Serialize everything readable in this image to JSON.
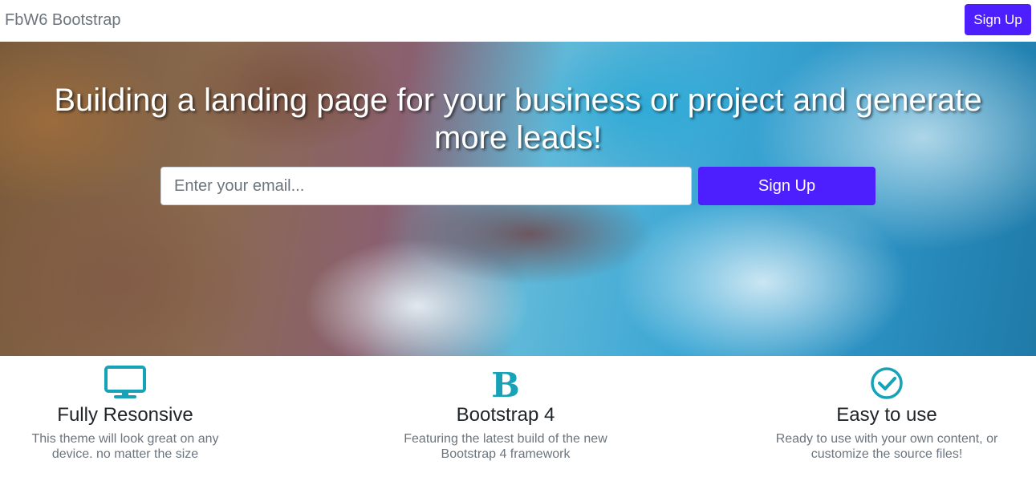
{
  "navbar": {
    "brand": "FbW6 Bootstrap",
    "signup_label": "Sign Up"
  },
  "hero": {
    "title": "Building a landing page for your business or project and generate more leads!",
    "email_placeholder": "Enter your email...",
    "signup_label": "Sign Up"
  },
  "features": [
    {
      "icon": "desktop-icon",
      "title": "Fully Resonsive",
      "text_line1": "This theme will look great on any",
      "text_line2": "device. no matter the size"
    },
    {
      "icon": "bootstrap-logo-icon",
      "title": "Bootstrap 4",
      "text_line1": "Featuring the latest build of the new",
      "text_line2": "Bootstrap 4 framework"
    },
    {
      "icon": "check-circle-icon",
      "title": "Easy to use",
      "text_line1": "Ready to use with your own content, or",
      "text_line2": "customize the source files!"
    }
  ],
  "colors": {
    "primary": "#4d1fff",
    "icon": "#17a2b8",
    "muted": "#6c757d"
  }
}
